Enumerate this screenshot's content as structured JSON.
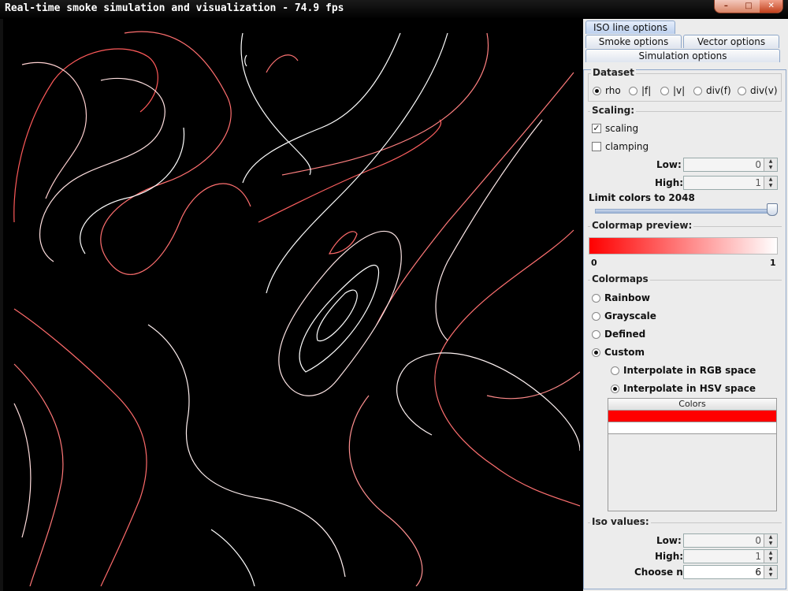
{
  "window": {
    "title": "Real-time smoke simulation and visualization - 74.9 fps",
    "buttons": {
      "minimize": "–",
      "maximize": "□",
      "close": "✕"
    }
  },
  "tabs": {
    "iso": "ISO line options",
    "smoke": "Smoke options",
    "vector": "Vector options",
    "simulation": "Simulation options"
  },
  "dataset": {
    "title": "Dataset",
    "options": [
      "rho",
      "|f|",
      "|v|",
      "div(f)",
      "div(v)"
    ],
    "selected": "rho"
  },
  "scaling": {
    "title": "Scaling:",
    "scaling_label": "scaling",
    "scaling_checked": true,
    "clamping_label": "clamping",
    "clamping_checked": false,
    "low_label": "Low:",
    "low_value": "0",
    "high_label": "High:",
    "high_value": "1",
    "limit_label": "Limit colors to 2048",
    "limit_level": 1.0
  },
  "colormap_preview": {
    "title": "Colormap preview:",
    "start_color": "#ff0000",
    "end_color": "#ffffff",
    "min_label": "0",
    "max_label": "1"
  },
  "colormaps": {
    "title": "Colormaps",
    "options": [
      "Rainbow",
      "Grayscale",
      "Defined",
      "Custom"
    ],
    "selected": "Custom",
    "interp_rgb": "Interpolate in RGB space",
    "interp_hsv": "Interpolate in HSV space",
    "interp_selected": "HSV",
    "colors_header": "Colors",
    "colors": [
      "#ff0000",
      "#ffffff"
    ]
  },
  "iso_values": {
    "title": "Iso values:",
    "low_label": "Low:",
    "low_value": "0",
    "high_label": "High:",
    "high_value": "1",
    "n_label": "Choose n:",
    "n_value": "6"
  },
  "colors": {
    "background": "#000000",
    "iso_low": "#ff4a4a",
    "iso_high": "#ffffff",
    "panel_bg": "#ececec",
    "tab_border": "#8ea7c9"
  }
}
